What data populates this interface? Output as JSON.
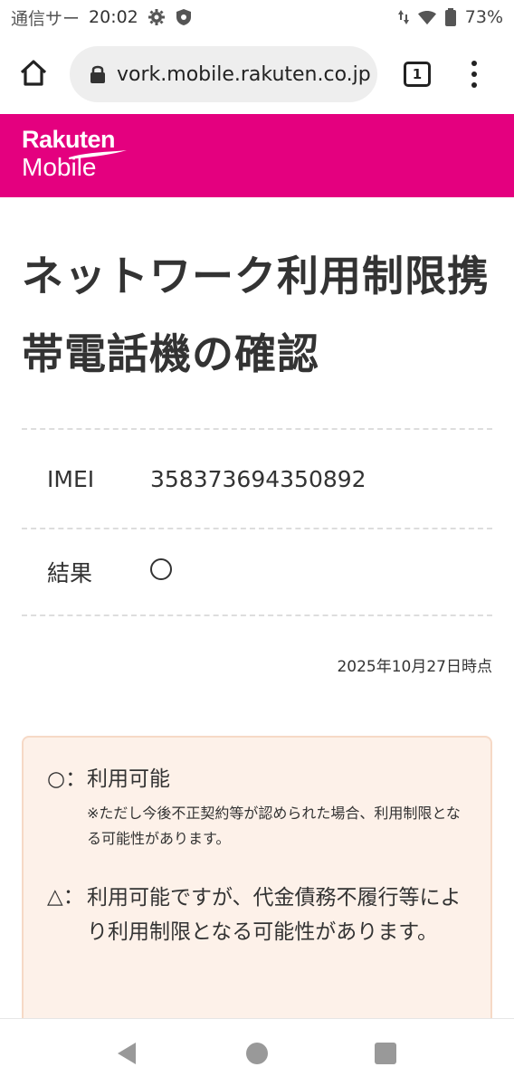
{
  "status_bar": {
    "carrier": "通信サー",
    "time": "20:02",
    "battery": "73%"
  },
  "browser": {
    "url": "vork.mobile.rakuten.co.jp",
    "tab_count": "1"
  },
  "brand": {
    "line1": "Rakuten",
    "line2": "Mobile",
    "color": "#e4007f"
  },
  "page": {
    "title": "ネットワーク利用制限携帯電話機の確認",
    "rows": [
      {
        "label": "IMEI",
        "value": "358373694350892"
      },
      {
        "label": "結果",
        "value": "○"
      }
    ],
    "as_of": "2025年10月27日時点"
  },
  "legend": {
    "items": [
      {
        "symbol": "○：",
        "text": "利用可能",
        "note": "※ただし今後不正契約等が認められた場合、利用制限となる可能性があります。"
      },
      {
        "symbol": "△：",
        "text": "利用可能ですが、代金債務不履行等により利用制限となる可能性があります。",
        "note": ""
      }
    ]
  }
}
